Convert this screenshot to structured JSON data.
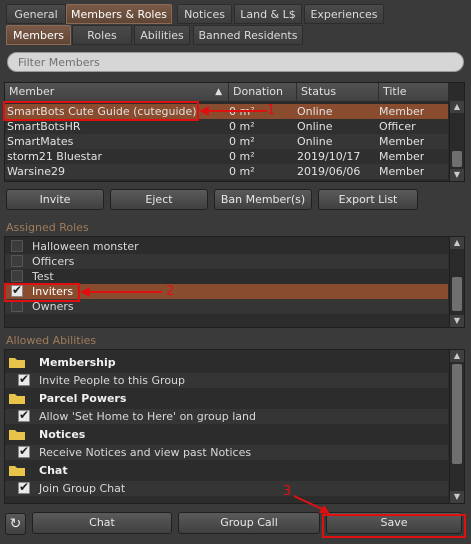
{
  "tabs_top": [
    "General",
    "Members & Roles",
    "Notices",
    "Land & L$",
    "Experiences"
  ],
  "tabs_sub": [
    "Members",
    "Roles",
    "Abilities",
    "Banned Residents"
  ],
  "filter_placeholder": "Filter Members",
  "table": {
    "headers": [
      "Member",
      "Donation",
      "Status",
      "Title"
    ],
    "rows": [
      {
        "member": "SmartBots Cute Guide (cuteguide)",
        "donation": "0 m²",
        "status": "Online",
        "title": "Member"
      },
      {
        "member": "SmartBotsHR",
        "donation": "0 m²",
        "status": "Online",
        "title": "Officer"
      },
      {
        "member": "SmartMates",
        "donation": "0 m²",
        "status": "Online",
        "title": "Member"
      },
      {
        "member": "storm21 Bluestar",
        "donation": "0 m²",
        "status": "2019/10/17",
        "title": "Member"
      },
      {
        "member": "Warsine29",
        "donation": "0 m²",
        "status": "2019/06/06",
        "title": "Member"
      }
    ]
  },
  "member_buttons": [
    "Invite",
    "Eject",
    "Ban Member(s)",
    "Export List"
  ],
  "assigned_roles_label": "Assigned Roles",
  "roles": [
    {
      "label": "Halloween monster",
      "checked": false
    },
    {
      "label": "Officers",
      "checked": false
    },
    {
      "label": "Test",
      "checked": false
    },
    {
      "label": "Inviters",
      "checked": true
    },
    {
      "label": "Owners",
      "checked": false
    }
  ],
  "allowed_abilities_label": "Allowed Abilities",
  "abilities": [
    {
      "type": "category",
      "label": "Membership"
    },
    {
      "type": "item",
      "label": "Invite People to this Group"
    },
    {
      "type": "category",
      "label": "Parcel Powers"
    },
    {
      "type": "item",
      "label": "Allow 'Set Home to Here' on group land"
    },
    {
      "type": "category",
      "label": "Notices"
    },
    {
      "type": "item",
      "label": "Receive Notices and view past Notices"
    },
    {
      "type": "category",
      "label": "Chat"
    },
    {
      "type": "item",
      "label": "Join Group Chat"
    }
  ],
  "bottom_buttons": {
    "chat": "Chat",
    "group_call": "Group Call",
    "save": "Save"
  },
  "annotations": [
    "1",
    "2",
    "3"
  ],
  "colors": {
    "selection": "#8a4c2e",
    "annotation": "#e01010",
    "folder": "#e8c44a"
  }
}
